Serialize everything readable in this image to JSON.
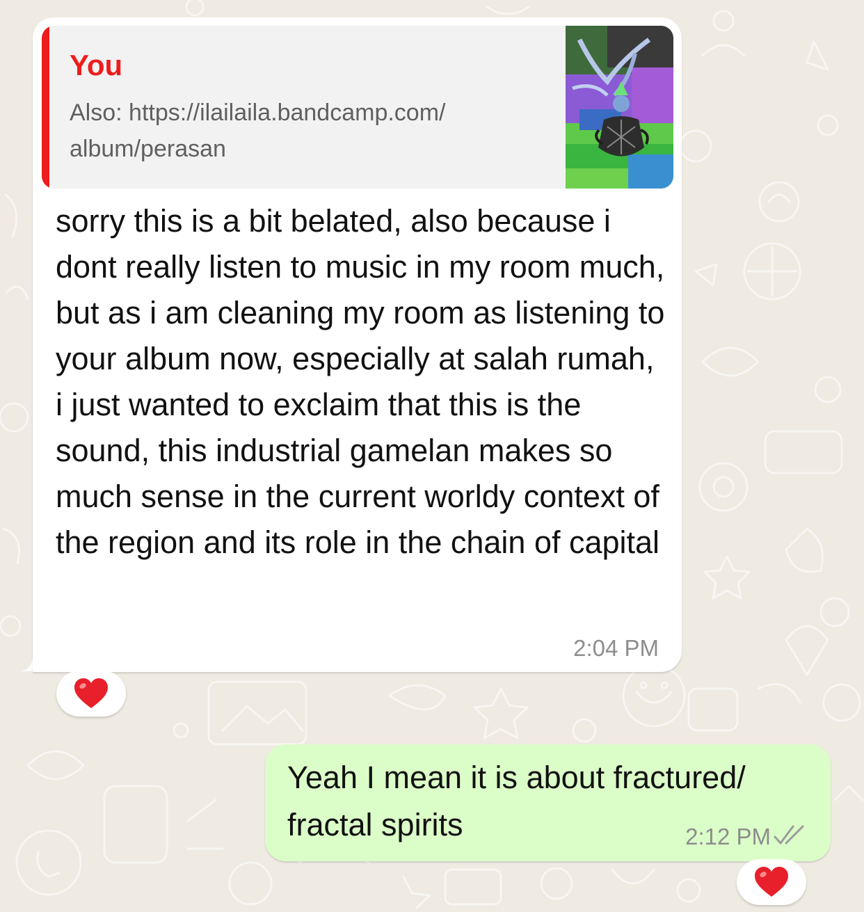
{
  "colors": {
    "background": "#efeae2",
    "incoming_bubble": "#ffffff",
    "outgoing_bubble": "#dbfdc8",
    "quote_accent": "#ee1d1d",
    "timestamp": "#8d8d8d",
    "read_ticks": "#9b9b9b"
  },
  "incoming": {
    "quote": {
      "author": "You",
      "line1": "Also: https://ilailaila.bandcamp.com/",
      "line2": "album/perasan",
      "thumbnail": "album-cover-image"
    },
    "text": "sorry this is a bit belated, also because i dont really listen to music in my room much, but as i am cleaning my room as listening to your album now, especially at salah rumah, i just wanted to exclaim that this is the sound, this industrial gamelan makes so much sense in the current worldy context of the region and its role in the chain of capital",
    "time": "2:04 PM",
    "reaction": "❤️"
  },
  "outgoing": {
    "text": "Yeah I mean it is about fractured/ fractal spirits",
    "time": "2:12 PM",
    "status_icon": "double-check-icon",
    "reaction": "❤️"
  }
}
